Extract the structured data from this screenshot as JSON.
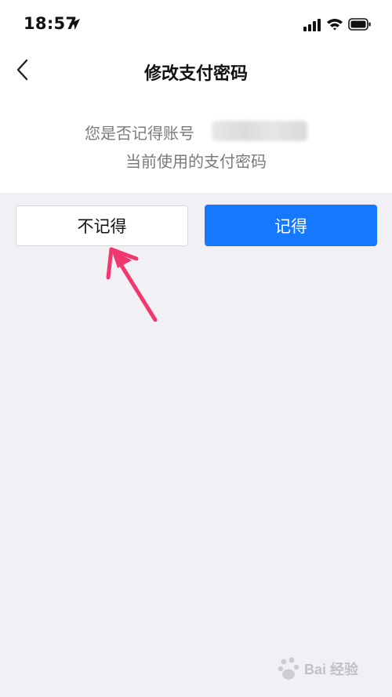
{
  "status_bar": {
    "time": "18:57",
    "icons": [
      "location-arrow-icon",
      "cellular-signal-icon",
      "wifi-icon",
      "battery-icon"
    ]
  },
  "nav": {
    "back_icon": "chevron-left-icon",
    "title": "修改支付密码"
  },
  "prompt": {
    "line1_prefix": "您是否记得账号",
    "line2": "当前使用的支付密码"
  },
  "buttons": {
    "not_remember": "不记得",
    "remember": "记得"
  },
  "colors": {
    "primary": "#1677ff",
    "background": "#f1f0f5",
    "annotation": "#f0386f"
  },
  "watermark": {
    "text": "Bai 经验"
  }
}
